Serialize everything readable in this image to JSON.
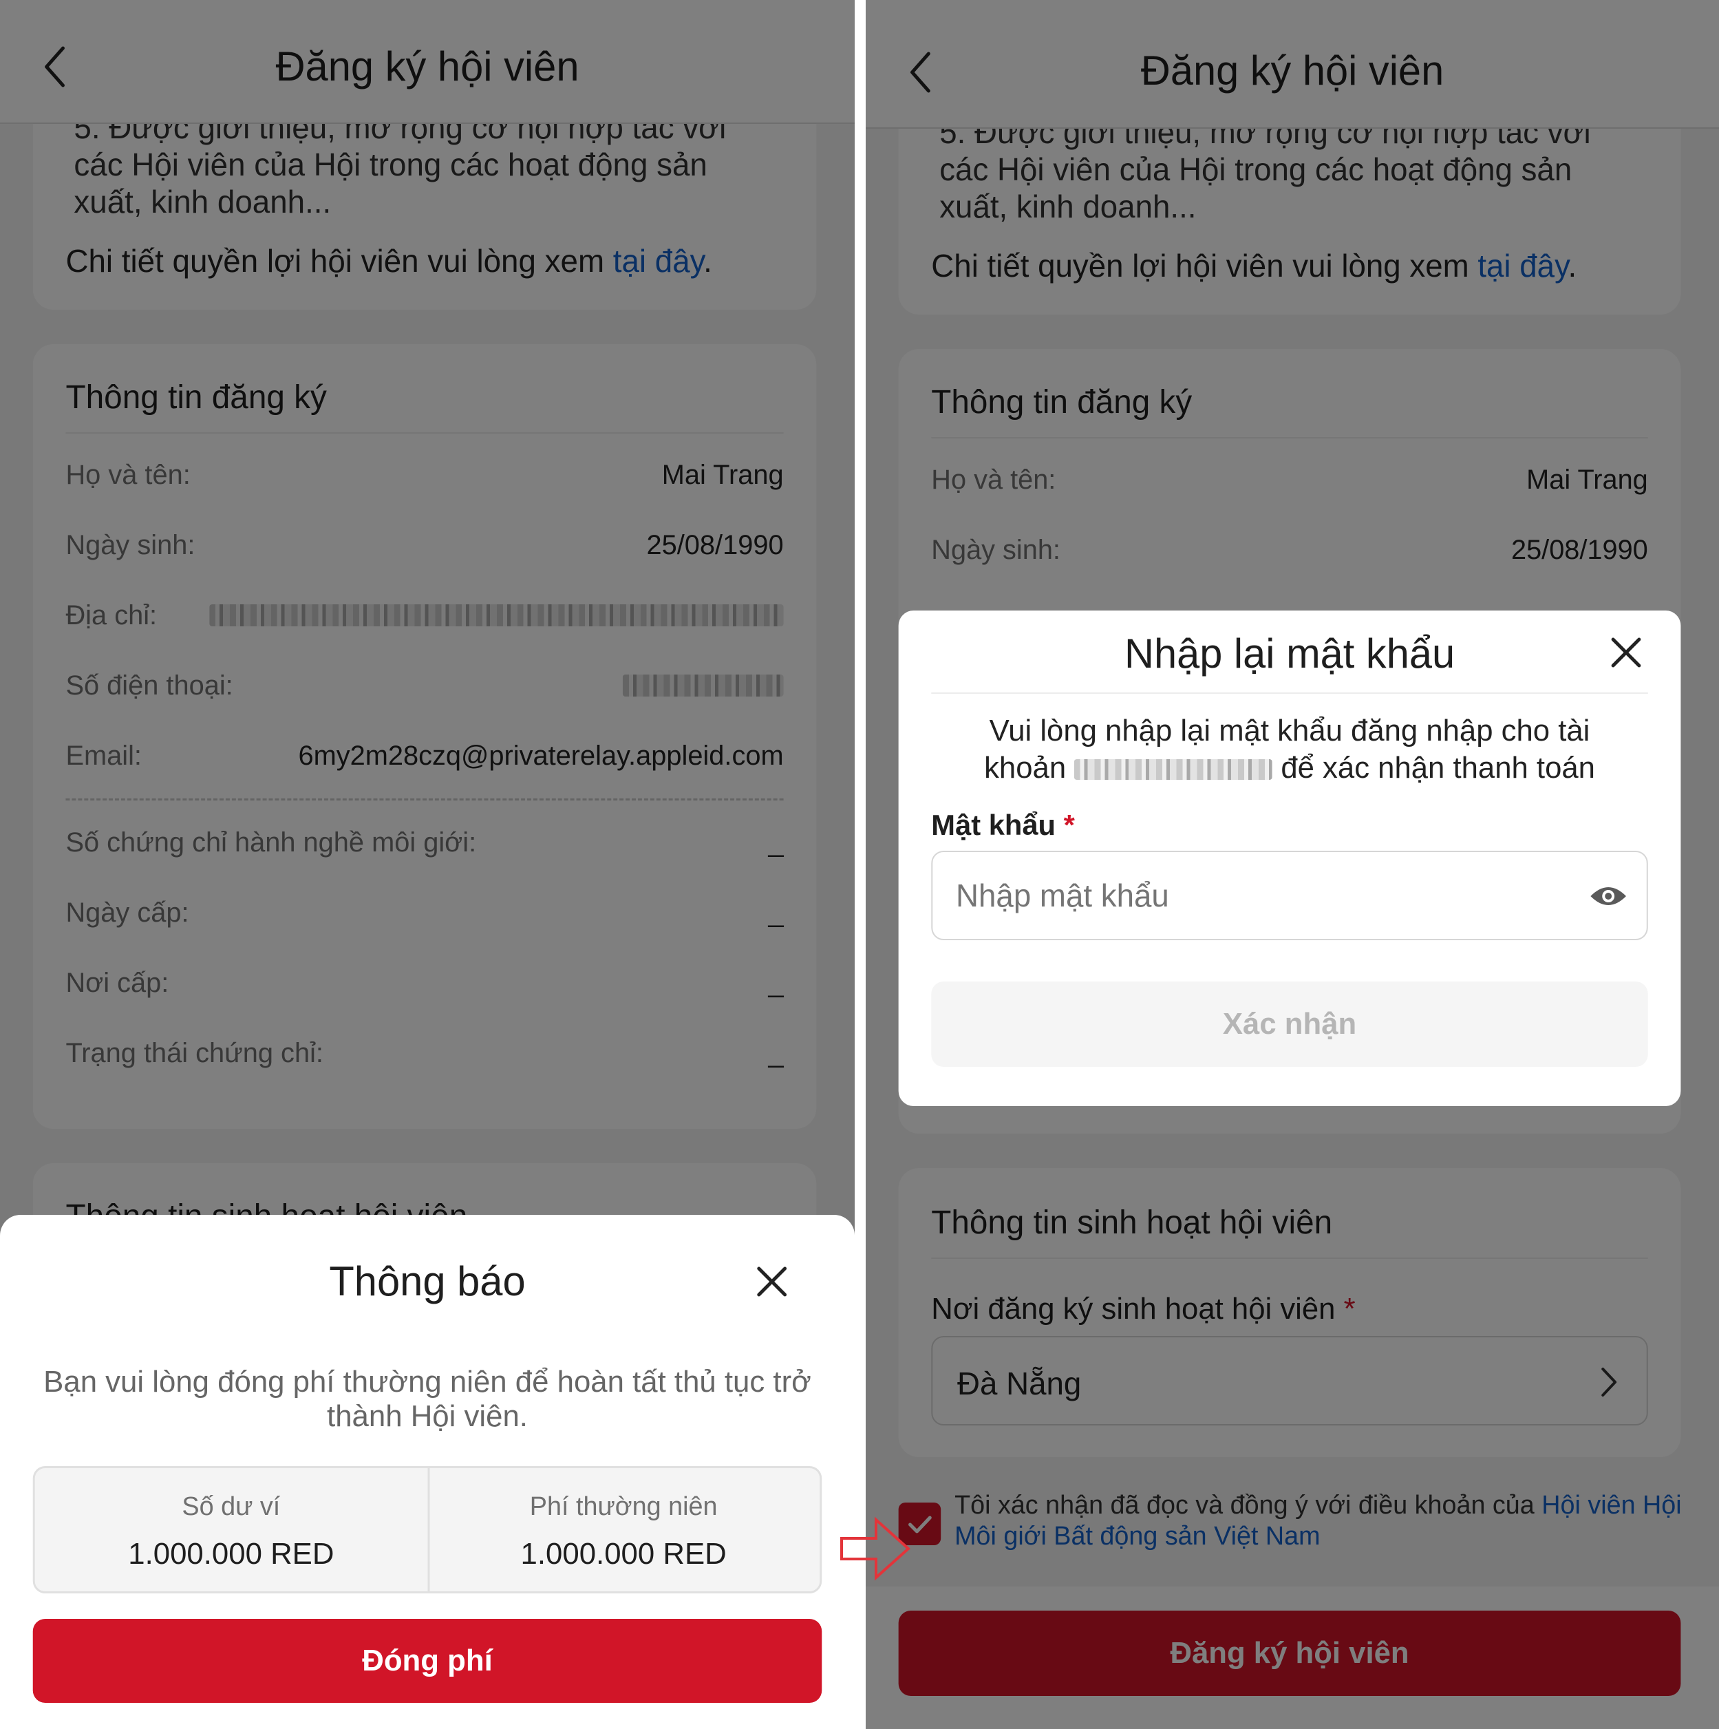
{
  "header": {
    "title": "Đăng ký hội viên"
  },
  "benefits": {
    "item5": "5. Được giới thiệu, mở rộng cơ hội hợp tác với các Hội viên của Hội trong các hoạt động sản xuất, kinh doanh...",
    "details_text": "Chi tiết quyền lợi hội viên vui lòng xem ",
    "details_link": "tại đây",
    "details_end": "."
  },
  "registration": {
    "title": "Thông tin đăng ký",
    "name_label": "Họ và tên:",
    "name_value": "Mai Trang",
    "dob_label": "Ngày sinh:",
    "dob_value": "25/08/1990",
    "address_label": "Địa chỉ:",
    "phone_label": "Số điện thoại:",
    "email_label": "Email:",
    "email_value": "6my2m28czq@privaterelay.appleid.com",
    "cert_label": "Số chứng chỉ hành nghề môi giới:",
    "cert_value": "_",
    "issue_date_label": "Ngày cấp:",
    "issue_date_value": "_",
    "issue_place_label": "Nơi cấp:",
    "issue_place_value": "_",
    "cert_status_label": "Trạng thái chứng chỉ:",
    "cert_status_value": "_"
  },
  "activity": {
    "title": "Thông tin sinh hoạt hội viên",
    "place_label": "Nơi đăng ký sinh hoạt hội viên",
    "required_mark": "*",
    "place_value": "Đà Nẵng"
  },
  "agreement": {
    "checked": true,
    "text": "Tôi xác nhận đã đọc và đồng ý với điều khoản của ",
    "link": "Hội viên Hội Môi giới Bất động sản Việt Nam"
  },
  "register_button": "Đăng ký hội viên",
  "notice_sheet": {
    "title": "Thông báo",
    "message": "Bạn vui lòng đóng phí thường niên để hoàn tất thủ tục trở thành Hội viên.",
    "balance_label": "Số dư ví",
    "balance_value": "1.000.000 RED",
    "fee_label": "Phí thường niên",
    "fee_value": "1.000.000 RED",
    "pay_button": "Đóng phí"
  },
  "password_modal": {
    "title": "Nhập lại mật khẩu",
    "message_part1": "Vui lòng nhập lại mật khẩu đăng nhập cho tài",
    "message_part2": "khoản",
    "message_part3": "để xác nhận thanh toán",
    "password_label": "Mật khẩu",
    "required_mark": "*",
    "password_placeholder": "Nhập mật khẩu",
    "confirm_button": "Xác nhận"
  },
  "colors": {
    "primary_red": "#d11528",
    "link_blue": "#1561c9",
    "divider": "#ffffff",
    "arrow_red": "#e3343a"
  },
  "icons": [
    "back-chevron-icon",
    "close-icon",
    "eye-icon",
    "chevron-right-icon",
    "checkmark-icon",
    "red-arrow-icon"
  ]
}
